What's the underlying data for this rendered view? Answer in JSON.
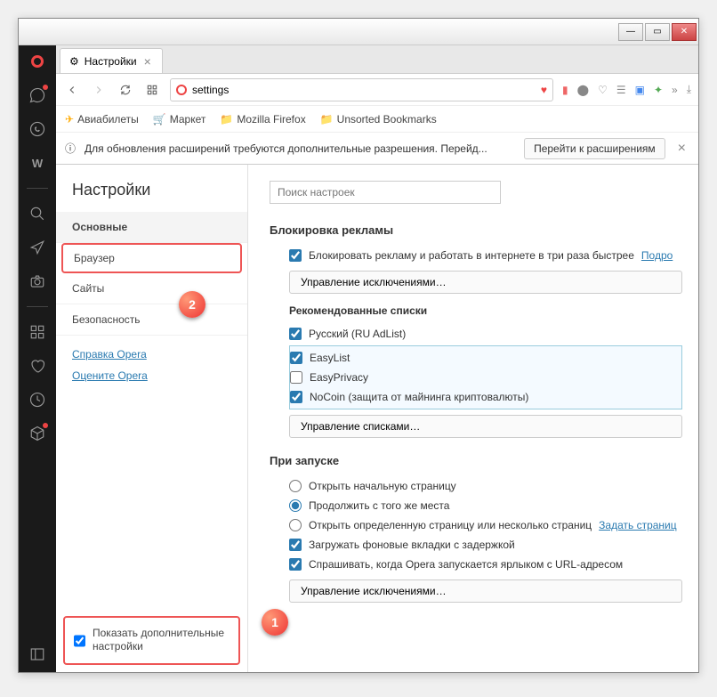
{
  "window": {
    "minimize": "—",
    "maximize": "▭",
    "close": "✕"
  },
  "tab": {
    "title": "Настройки",
    "icon": "gear"
  },
  "nav": {
    "url": "settings"
  },
  "bookmarks": {
    "aviabilety": "Авиабилеты",
    "market": "Маркет",
    "mozilla": "Mozilla Firefox",
    "unsorted": "Unsorted Bookmarks"
  },
  "notice": {
    "text": "Для обновления расширений требуются дополнительные разрешения. Перейд...",
    "button": "Перейти к расширениям"
  },
  "settings": {
    "title": "Настройки",
    "search_placeholder": "Поиск настроек",
    "nav": {
      "basic": "Основные",
      "browser": "Браузер",
      "sites": "Сайты",
      "security": "Безопасность"
    },
    "links": {
      "help": "Справка Opera",
      "rate": "Оцените Opera"
    },
    "show_advanced": "Показать дополнительные настройки"
  },
  "adblock": {
    "title": "Блокировка рекламы",
    "block_label": "Блокировать рекламу и работать в интернете в три раза быстрее",
    "more": "Подро",
    "manage_exceptions": "Управление исключениями…",
    "rec_title": "Рекомендованные списки",
    "lists": {
      "ru": "Русский (RU AdList)",
      "easylist": "EasyList",
      "easyprivacy": "EasyPrivacy",
      "nocoin": "NoCoin (защита от майнинга криптовалюты)"
    },
    "manage_lists": "Управление списками…"
  },
  "startup": {
    "title": "При запуске",
    "open_home": "Открыть начальную страницу",
    "continue": "Продолжить с того же места",
    "open_page": "Открыть определенную страницу или несколько страниц",
    "set_pages": "Задать страниц",
    "load_bg": "Загружать фоновые вкладки с задержкой",
    "ask_shortcut": "Спрашивать, когда Opera запускается ярлыком с URL-адресом",
    "manage_exceptions": "Управление исключениями…"
  },
  "callouts": {
    "one": "1",
    "two": "2"
  }
}
